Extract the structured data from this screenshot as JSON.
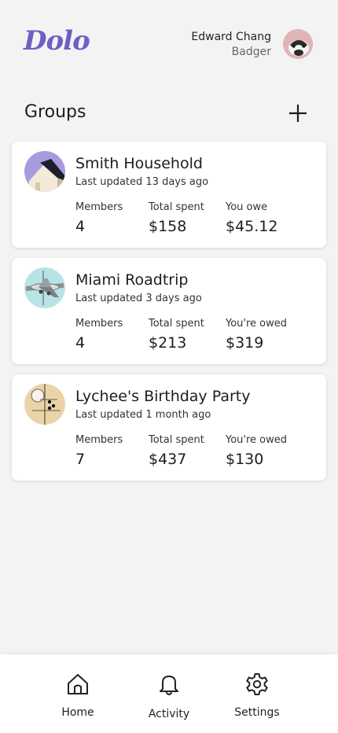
{
  "header": {
    "logo": "Dolo",
    "user_name": "Edward Chang",
    "user_subtitle": "Badger"
  },
  "groups": {
    "title": "Groups",
    "list": [
      {
        "name": "Smith Household",
        "updated": "Last updated 13 days ago",
        "members_label": "Members",
        "members": "4",
        "spent_label": "Total spent",
        "spent": "$158",
        "balance_label": "You owe",
        "balance": "$45.12",
        "image": "house-icon"
      },
      {
        "name": "Miami Roadtrip",
        "updated": "Last updated 3 days ago",
        "members_label": "Members",
        "members": "4",
        "spent_label": "Total spent",
        "spent": "$213",
        "balance_label": "You're owed",
        "balance": "$319",
        "image": "airplane-icon"
      },
      {
        "name": "Lychee's Birthday Party",
        "updated": "Last updated 1 month ago",
        "members_label": "Members",
        "members": "7",
        "spent_label": "Total spent",
        "spent": "$437",
        "balance_label": "You're owed",
        "balance": "$130",
        "image": "abstract-art-icon"
      }
    ]
  },
  "nav": {
    "home": "Home",
    "activity": "Activity",
    "settings": "Settings"
  },
  "colors": {
    "accent": "#6f5fc4",
    "background": "#f3f3f4",
    "card": "#ffffff"
  }
}
